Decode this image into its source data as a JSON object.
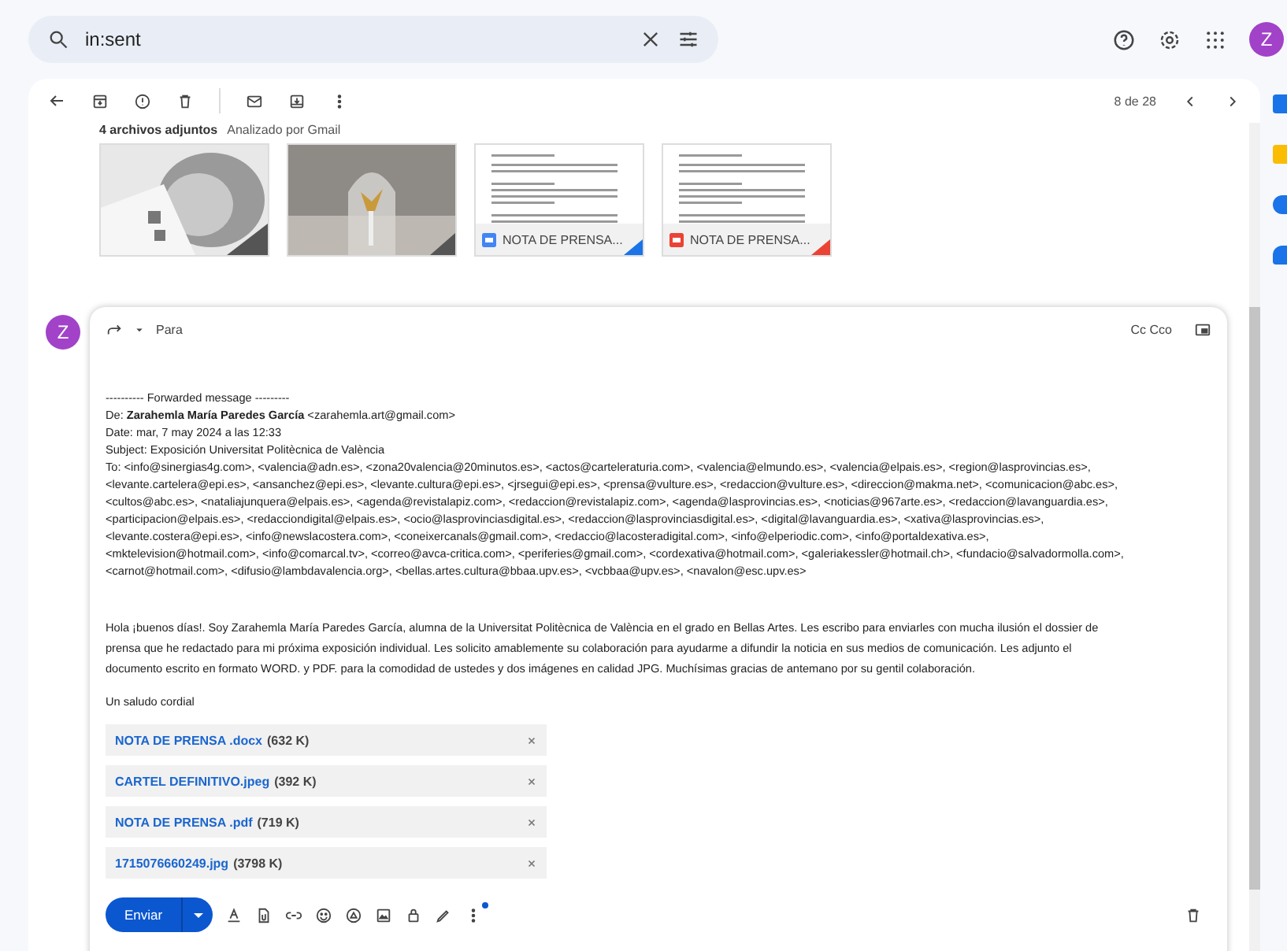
{
  "search": {
    "query": "in:sent"
  },
  "account": {
    "avatar": "Z"
  },
  "toolbar": {
    "pager": "8 de 28"
  },
  "attachments_header": {
    "title": "4 archivos adjuntos",
    "note": "Analizado por Gmail"
  },
  "attachment_cards": [
    {
      "kind": "picture"
    },
    {
      "kind": "picture"
    },
    {
      "kind": "word",
      "label": "NOTA DE PRENSA..."
    },
    {
      "kind": "pdf",
      "label": "NOTA DE PRENSA..."
    }
  ],
  "compose": {
    "avatar": "Z",
    "to_label": "Para",
    "cc_label": "Cc Cco",
    "forwarded_header": "---------- Forwarded message ---------",
    "from_line": "De: **Zarahemla María Paredes García** <zarahemla.art@gmail.com>",
    "date_line": "Date: mar, 7 may 2024 a las 12:33",
    "subject_line": "Subject: Exposición Universitat Politècnica de València",
    "to_lines": [
      "To: <info@sinergias4g.com>, <valencia@adn.es>, <zona20valencia@20minutos.es>, <actos@carteleraturia.com>, <valencia@elmundo.es>, <valencia@elpais.es>, <region@lasprovincias.es>,",
      "<levante.cartelera@epi.es>, <ansanchez@epi.es>, <levante.cultura@epi.es>, <jrsegui@epi.es>, <prensa@vulture.es>, <redaccion@vulture.es>, <direccion@makma.net>, <comunicacion@abc.es>,",
      "<cultos@abc.es>, <nataliajunquera@elpais.es>, <agenda@revistalapiz.com>, <redaccion@revistalapiz.com>, <agenda@lasprovincias.es>, <noticias@967arte.es>, <redaccion@lavanguardia.es>,",
      "<participacion@elpais.es>, <redacciondigital@elpais.es>, <ocio@lasprovinciasdigital.es>, <redaccion@lasprovinciasdigital.es>, <digital@lavanguardia.es>, <xativa@lasprovincias.es>,",
      "<levante.costera@epi.es>, <info@newslacostera.com>, <coneixercanals@gmail.com>, <redaccio@lacosteradigital.com>, <info@elperiodic.com>, <info@portaldexativa.es>,",
      "<mktelevision@hotmail.com>, <info@comarcal.tv>, <correo@avca-critica.com>, <periferies@gmail.com>, <cordexativa@hotmail.com>, <galeriakessler@hotmail.ch>, <fundacio@salvadormolla.com>,",
      "<carnot@hotmail.com>, <difusio@lambdavalencia.org>, <bellas.artes.cultura@bbaa.upv.es>, <vcbbaa@upv.es>, <navalon@esc.upv.es>"
    ],
    "body_lines": [
      "Hola ¡buenos días!. Soy Zarahemla María Paredes García, alumna de la Universitat Politècnica de València en el grado en Bellas Artes. Les escribo para enviarles con mucha ilusión el dossier de",
      "prensa que he redactado para mi próxima exposición individual. Les solicito amablemente su colaboración para ayudarme a difundir la noticia en sus medios de comunicación. Les adjunto el",
      "documento escrito en formato WORD. y PDF. para la comodidad de ustedes y dos imágenes en calidad JPG. Muchísimas gracias de antemano por su gentil colaboración."
    ],
    "closing": "Un saludo cordial",
    "files": [
      {
        "name": "NOTA DE PRENSA .docx",
        "size": "(632 K)"
      },
      {
        "name": "CARTEL DEFINITIVO.jpeg",
        "size": "(392 K)"
      },
      {
        "name": "NOTA DE PRENSA .pdf",
        "size": "(719 K)"
      },
      {
        "name": "1715076660249.jpg",
        "size": "(3798 K)"
      }
    ],
    "send_label": "Enviar"
  }
}
